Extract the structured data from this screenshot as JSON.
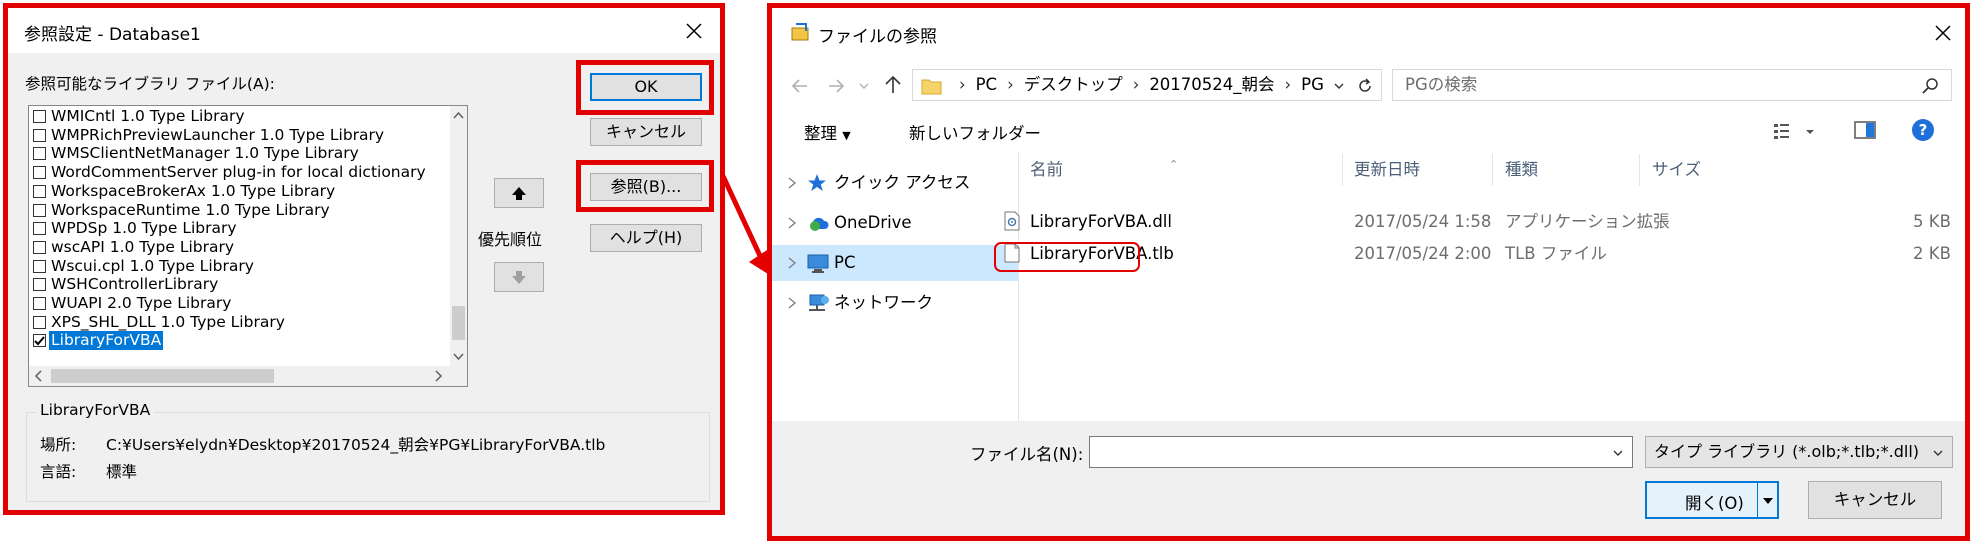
{
  "ref_dialog": {
    "title": "参照設定 - Database1",
    "list_label": "参照可能なライブラリ ファイル(A):",
    "libraries": [
      {
        "name": "WMICntl 1.0 Type Library",
        "checked": false
      },
      {
        "name": "WMPRichPreviewLauncher 1.0 Type Library",
        "checked": false
      },
      {
        "name": "WMSClientNetManager 1.0 Type Library",
        "checked": false
      },
      {
        "name": "WordCommentServer plug-in for local dictionary",
        "checked": false
      },
      {
        "name": "WorkspaceBrokerAx 1.0 Type Library",
        "checked": false
      },
      {
        "name": "WorkspaceRuntime 1.0 Type Library",
        "checked": false
      },
      {
        "name": "WPDSp 1.0 Type Library",
        "checked": false
      },
      {
        "name": "wscAPI 1.0 Type Library",
        "checked": false
      },
      {
        "name": "Wscui.cpl 1.0 Type Library",
        "checked": false
      },
      {
        "name": "WSHControllerLibrary",
        "checked": false
      },
      {
        "name": "WUAPI 2.0 Type Library",
        "checked": false
      },
      {
        "name": "XPS_SHL_DLL 1.0 Type Library",
        "checked": false
      },
      {
        "name": "LibraryForVBA",
        "checked": true,
        "selected": true
      }
    ],
    "ok_label": "OK",
    "cancel_label": "キャンセル",
    "browse_label": "参照(B)...",
    "help_label": "ヘルプ(H)",
    "priority_label": "優先順位",
    "info": {
      "group_title": "LibraryForVBA",
      "location_label": "場所:",
      "location_value": "C:¥Users¥elydn¥Desktop¥20170524_朝会¥PG¥LibraryForVBA.tlb",
      "language_label": "言語:",
      "language_value": "標準"
    }
  },
  "file_dialog": {
    "title": "ファイルの参照",
    "breadcrumb": [
      "PC",
      "デスクトップ",
      "20170524_朝会",
      "PG"
    ],
    "search_placeholder": "PGの検索",
    "organize_label": "整理",
    "new_folder_label": "新しいフォルダー",
    "nav": [
      {
        "label": "クイック アクセス",
        "icon": "star-icon"
      },
      {
        "label": "OneDrive",
        "icon": "cloud-icon"
      },
      {
        "label": "PC",
        "icon": "computer-icon",
        "selected": true
      },
      {
        "label": "ネットワーク",
        "icon": "network-icon"
      }
    ],
    "columns": {
      "name": "名前",
      "modified": "更新日時",
      "type": "種類",
      "size": "サイズ"
    },
    "files": [
      {
        "name": "LibraryForVBA.dll",
        "modified": "2017/05/24 1:58",
        "type": "アプリケーション拡張",
        "size": "5 KB"
      },
      {
        "name": "LibraryForVBA.tlb",
        "modified": "2017/05/24 2:00",
        "type": "TLB ファイル",
        "size": "2 KB"
      }
    ],
    "filename_label": "ファイル名(N):",
    "filename_value": "",
    "filter_value": "タイプ ライブラリ (*.olb;*.tlb;*.dll)",
    "open_label": "開く(O)",
    "cancel_label": "キャンセル"
  },
  "colors": {
    "highlight_red": "#e30000",
    "selection_blue": "#0078d7",
    "nav_selected": "#cce8ff"
  }
}
